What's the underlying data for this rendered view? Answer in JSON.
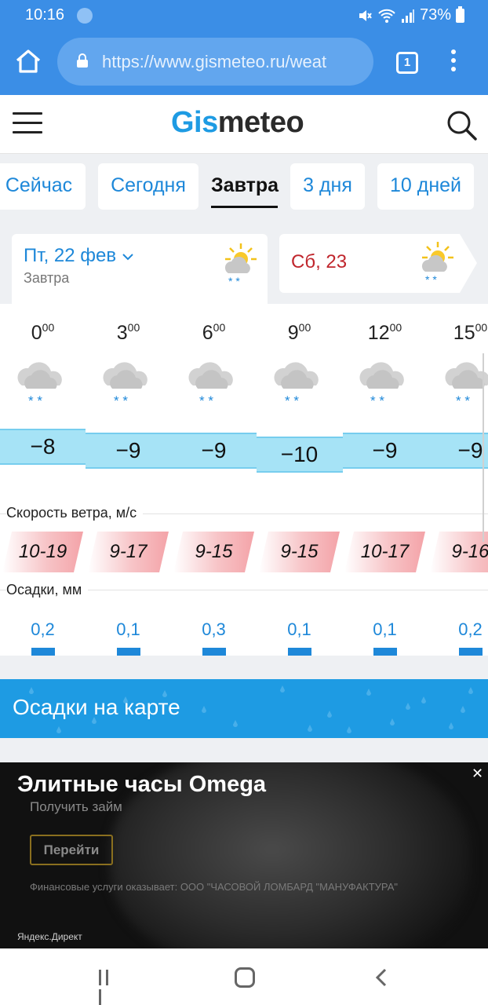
{
  "status_bar": {
    "time": "10:16",
    "battery": "73%"
  },
  "browser": {
    "url": "https://www.gismeteo.ru/weat",
    "tab_count": "1"
  },
  "site": {
    "logo_part1": "Gis",
    "logo_part2": "meteo"
  },
  "tabs": [
    {
      "label": "Сейчас"
    },
    {
      "label": "Сегодня"
    },
    {
      "label": "Завтра"
    },
    {
      "label": "3 дня"
    },
    {
      "label": "10 дней"
    }
  ],
  "days": [
    {
      "date": "Пт, 22 фев",
      "label": "Завтра"
    },
    {
      "date": "Сб, 23"
    }
  ],
  "forecast": [
    {
      "hour": "0",
      "min": "00",
      "temp": "−8",
      "wind": "10-19",
      "precip": "0,2"
    },
    {
      "hour": "3",
      "min": "00",
      "temp": "−9",
      "wind": "9-17",
      "precip": "0,1"
    },
    {
      "hour": "6",
      "min": "00",
      "temp": "−9",
      "wind": "9-15",
      "precip": "0,3"
    },
    {
      "hour": "9",
      "min": "00",
      "temp": "−10",
      "wind": "9-15",
      "precip": "0,1"
    },
    {
      "hour": "12",
      "min": "00",
      "temp": "−9",
      "wind": "10-17",
      "precip": "0,1"
    },
    {
      "hour": "15",
      "min": "00",
      "temp": "−9",
      "wind": "9-16",
      "precip": "0,2"
    }
  ],
  "labels": {
    "wind": "Скорость ветра, м/с",
    "precip": "Осадки, мм"
  },
  "map_banner": "Осадки на карте",
  "ad": {
    "title": "Элитные часы Omega",
    "subtitle": "Получить займ",
    "button": "Перейти",
    "legal": "Финансовые услуги оказывает: ООО \"ЧАСОВОЙ ЛОМБАРД \"МАНУФАКТУРА\"",
    "source": "Яндекс.Директ",
    "close": "✕"
  },
  "colors": {
    "chrome": "#3b8ee6",
    "brand_blue": "#1e9be3",
    "link_blue": "#1e88d9",
    "temp_band": "#a6e3f6",
    "wind_band": "#f4a3a8",
    "weekend_red": "#c0262d"
  }
}
